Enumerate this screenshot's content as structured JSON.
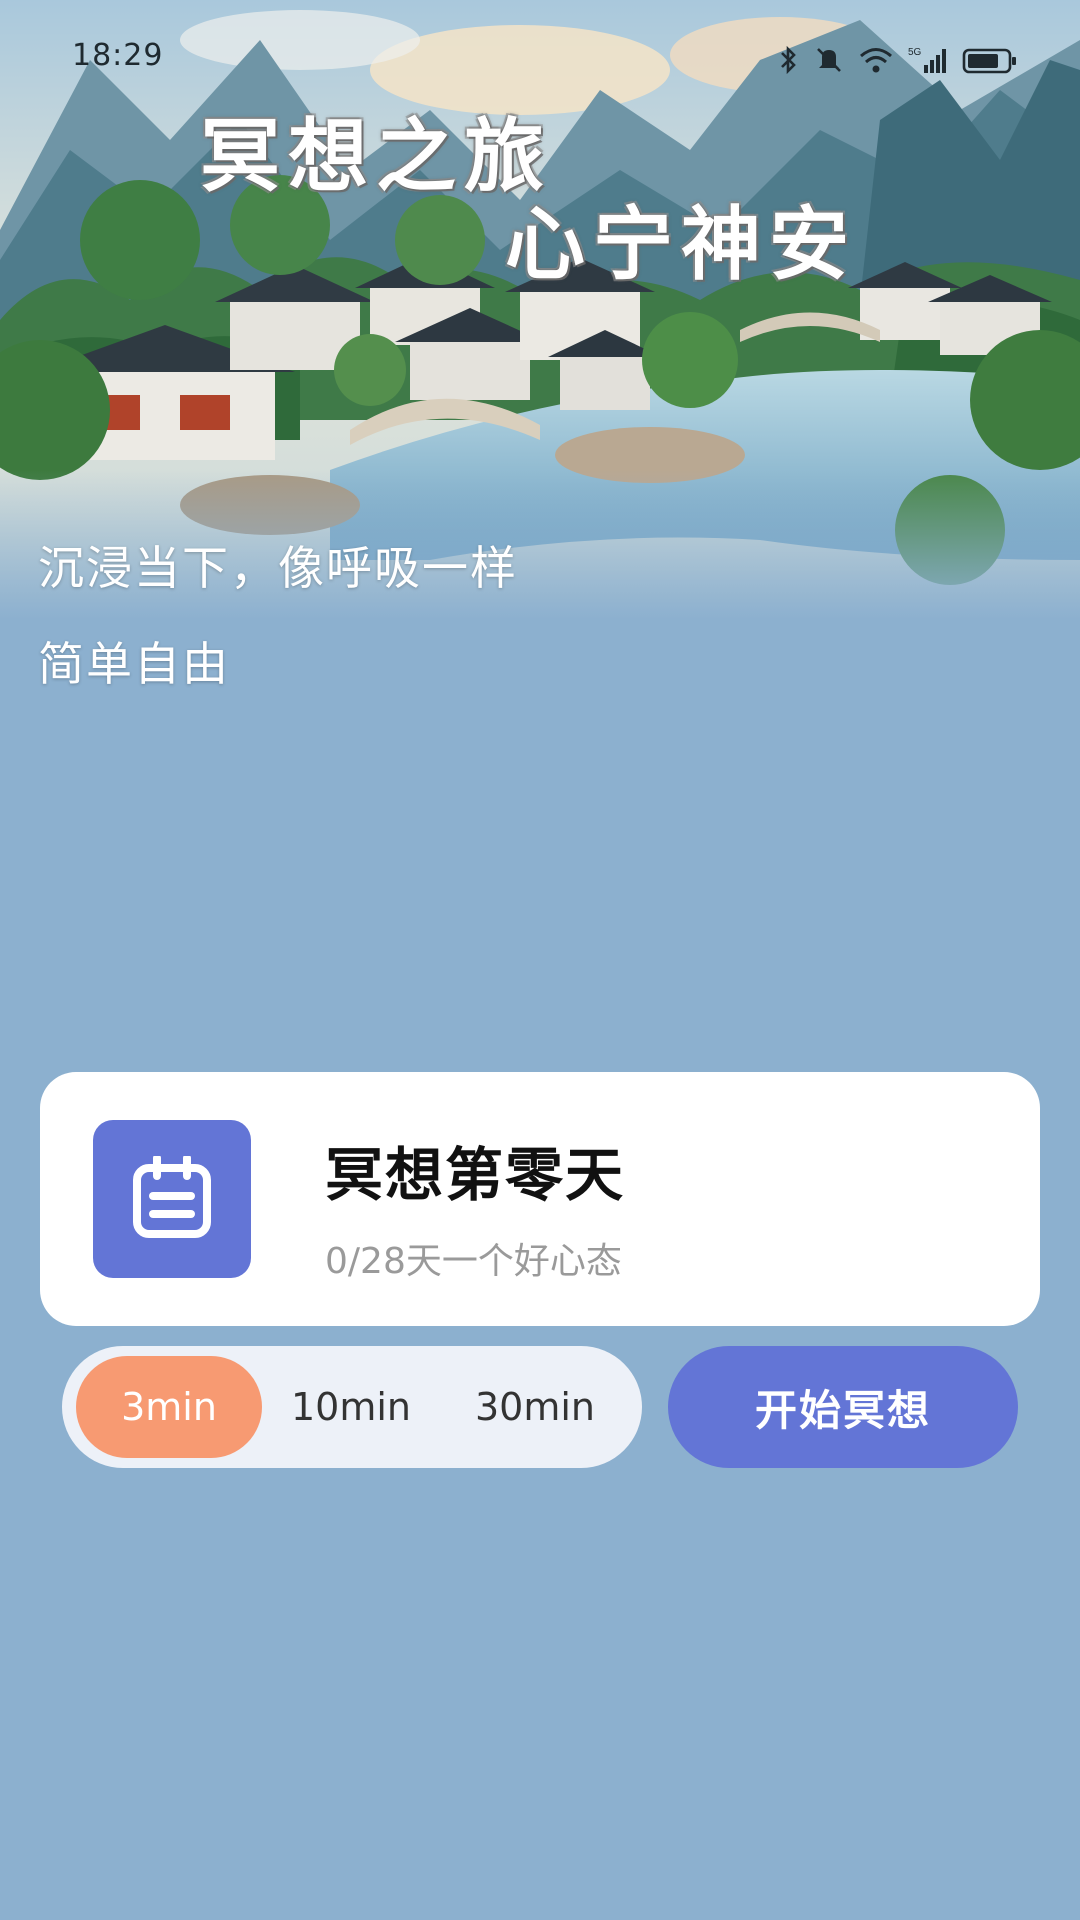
{
  "status_bar": {
    "time": "18:29",
    "icons": [
      "bluetooth-icon",
      "mute-icon",
      "wifi-icon",
      "signal-5g-icon",
      "battery-icon"
    ]
  },
  "hero": {
    "title_line_1": "冥想之旅",
    "title_line_2": "心宁神安",
    "subtitle_line_1": "沉浸当下，像呼吸一样",
    "subtitle_line_2": "简单自由"
  },
  "progress_card": {
    "icon": "calendar-icon",
    "title": "冥想第零天",
    "subtitle": "0/28天一个好心态"
  },
  "duration": {
    "options": [
      "3min",
      "10min",
      "30min"
    ],
    "selected": "3min"
  },
  "start_button": {
    "label": "开始冥想"
  },
  "colors": {
    "page_background": "#8cb0cf",
    "accent_blue": "#6375d6",
    "selected_orange": "#f79a72",
    "card_background": "#ffffff",
    "selector_background": "#edf1f8"
  }
}
